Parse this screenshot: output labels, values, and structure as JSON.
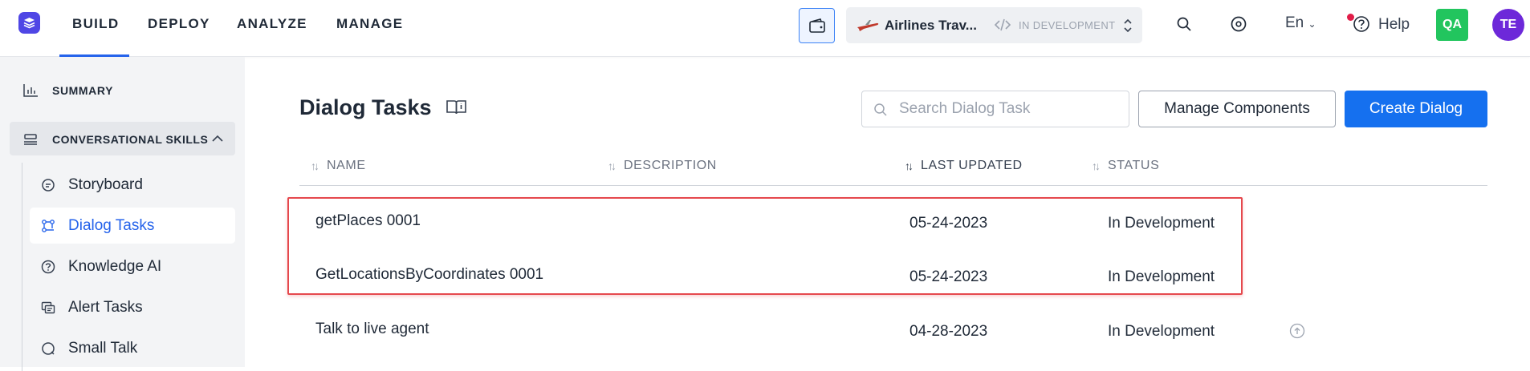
{
  "topnav": {
    "items": [
      "BUILD",
      "DEPLOY",
      "ANALYZE",
      "MANAGE"
    ],
    "app_name": "Airlines Trav...",
    "environment": "IN DEVELOPMENT",
    "language": "En",
    "help_label": "Help",
    "avatar_qa": "QA",
    "avatar_te": "TE"
  },
  "sidebar": {
    "summary": "SUMMARY",
    "section": "CONVERSATIONAL SKILLS",
    "items": [
      {
        "label": "Storyboard",
        "icon": "storyboard-icon"
      },
      {
        "label": "Dialog Tasks",
        "icon": "dialog-tasks-icon",
        "active": true
      },
      {
        "label": "Knowledge AI",
        "icon": "help-circle-icon"
      },
      {
        "label": "Alert Tasks",
        "icon": "alert-tasks-icon"
      },
      {
        "label": "Small Talk",
        "icon": "chat-bubble-icon"
      }
    ]
  },
  "main": {
    "title": "Dialog Tasks",
    "search_placeholder": "Search Dialog Task",
    "manage_label": "Manage Components",
    "create_label": "Create Dialog",
    "columns": [
      "NAME",
      "DESCRIPTION",
      "LAST UPDATED",
      "STATUS"
    ],
    "rows": [
      {
        "name": "getPlaces 0001",
        "description": "",
        "updated": "05-24-2023",
        "status": "In Development"
      },
      {
        "name": "GetLocationsByCoordinates 0001",
        "description": "",
        "updated": "05-24-2023",
        "status": "In Development"
      },
      {
        "name": "Talk to live agent",
        "description": "",
        "updated": "04-28-2023",
        "status": "In Development"
      }
    ]
  },
  "colors": {
    "accent": "#1570ef",
    "highlight": "#e5484d",
    "avatar_qa": "#22c55e",
    "avatar_te": "#6d28d9"
  }
}
